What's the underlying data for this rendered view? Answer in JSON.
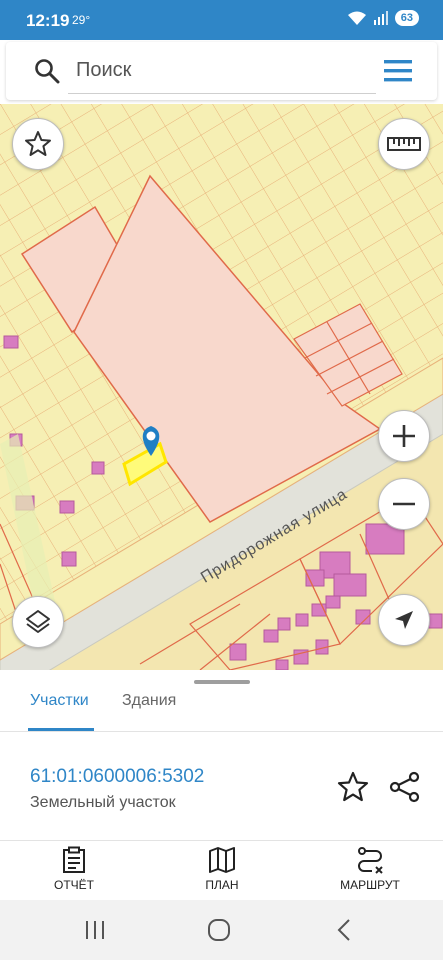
{
  "status_bar": {
    "time": "12:19",
    "temperature": "29°",
    "battery": "63"
  },
  "search": {
    "placeholder": "Поиск"
  },
  "map": {
    "street_name": "Придорожная улица",
    "controls": [
      "favorite-star",
      "ruler",
      "zoom-in",
      "zoom-out",
      "layers",
      "my-location"
    ],
    "colors": {
      "land": "#f6efb4",
      "parcel_border": "#e2956a",
      "parcel_fill": "#f8d8cc",
      "building": "#d77cc0",
      "road": "#e0e0d8",
      "selected": "#ffff00",
      "marker": "#1f7fc4"
    }
  },
  "sheet": {
    "tabs": [
      {
        "label": "Участки",
        "active": true
      },
      {
        "label": "Здания",
        "active": false
      }
    ],
    "parcel": {
      "number": "61:01:0600006:5302",
      "type": "Земельный участок"
    }
  },
  "bottom_nav": [
    {
      "label": "ОТЧЁТ",
      "icon": "clipboard-icon"
    },
    {
      "label": "ПЛАН",
      "icon": "map-icon"
    },
    {
      "label": "МАРШРУТ",
      "icon": "route-icon"
    }
  ],
  "accent_color": "#2f86c7"
}
